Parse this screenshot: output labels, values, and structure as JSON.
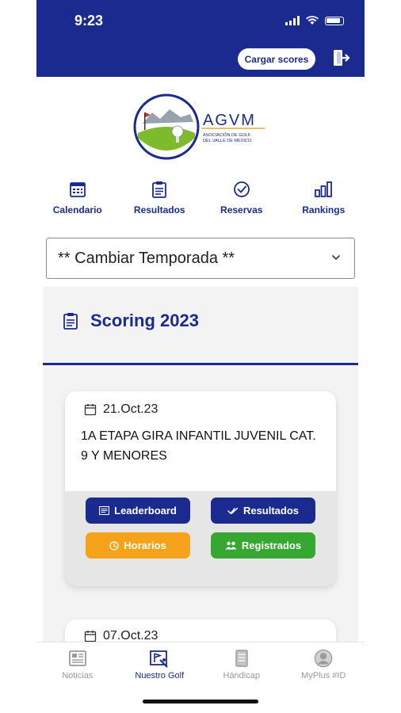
{
  "status_bar": {
    "time": "9:23"
  },
  "header": {
    "load_scores_label": "Cargar scores"
  },
  "logo": {
    "brand": "AGVM",
    "subtitle_line1": "ASOCIACIÓN DE GOLF",
    "subtitle_line2": "DEL VALLE DE MÉXICO"
  },
  "nav": [
    {
      "label": "Calendario",
      "icon": "calendar-icon"
    },
    {
      "label": "Resultados",
      "icon": "clipboard-icon"
    },
    {
      "label": "Reservas",
      "icon": "check-circle-icon"
    },
    {
      "label": "Rankings",
      "icon": "bar-chart-icon"
    }
  ],
  "season_select": {
    "value": "** Cambiar Temporada **"
  },
  "section": {
    "title": "Scoring 2023"
  },
  "events": [
    {
      "date": "21.Oct.23",
      "title": "1A ETAPA GIRA INFANTIL JUVENIL CAT. 9 Y MENORES",
      "buttons": {
        "leaderboard": "Leaderboard",
        "results": "Resultados",
        "schedule": "Horarios",
        "registered": "Registrados"
      }
    },
    {
      "date": "07.Oct.23"
    }
  ],
  "colors": {
    "primary": "#1b2a8f",
    "orange": "#f7a21b",
    "green": "#36a832",
    "inactive": "#9a9a9a"
  },
  "tabbar": [
    {
      "label": "Noticias",
      "icon": "newspaper-icon",
      "active": false
    },
    {
      "label": "Nuestro Golf",
      "icon": "golf-flag-icon",
      "active": true
    },
    {
      "label": "Hándicap",
      "icon": "scorecard-icon",
      "active": false
    },
    {
      "label": "MyPlus #ID",
      "icon": "user-icon",
      "active": false
    }
  ]
}
